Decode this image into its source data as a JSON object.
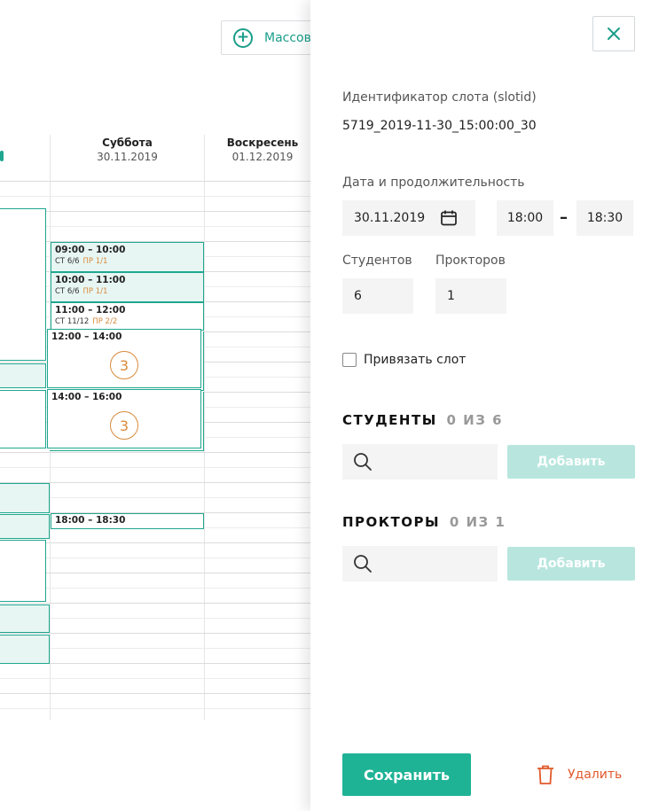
{
  "calendar": {
    "bulk_button_label": "Массов",
    "days": [
      {
        "name": "Суббота",
        "date": "30.11.2019"
      },
      {
        "name": "Воскресень",
        "date": "01.12.2019"
      }
    ],
    "slots": [
      {
        "time": "09:00 – 10:00",
        "students": "СТ 6/6",
        "proctors": "ПР 1/1"
      },
      {
        "time": "10:00 – 11:00",
        "students": "СТ 6/6",
        "proctors": "ПР 1/1"
      },
      {
        "time": "11:00 – 12:00",
        "students": "СТ 11/12",
        "proctors": "ПР 2/2"
      },
      {
        "time": "18:00 – 18:30"
      }
    ],
    "groups": [
      {
        "time": "12:00 – 14:00",
        "count": "3"
      },
      {
        "time": "14:00 – 16:00",
        "count": "3"
      }
    ]
  },
  "panel": {
    "slot_id_label": "Идентификатор слота (slotid)",
    "slot_id_value": "5719_2019-11-30_15:00:00_30",
    "date_duration_label": "Дата и продолжительность",
    "date_value": "30.11.2019",
    "time_start": "18:00",
    "time_separator": "–",
    "time_end": "18:30",
    "students_label": "Студентов",
    "students_value": "6",
    "proctors_label": "Прокторов",
    "proctors_value": "1",
    "bind_slot_label": "Привязать слот",
    "students_section": {
      "title": "СТУДЕНТЫ",
      "count": "0 ИЗ 6",
      "add_label": "Добавить"
    },
    "proctors_section": {
      "title": "ПРОКТОРЫ",
      "count": "0 ИЗ 1",
      "add_label": "Добавить"
    },
    "save_label": "Сохранить",
    "delete_label": "Удалить"
  },
  "colors": {
    "accent": "#1fb396",
    "accent_light": "#b8e6de",
    "danger": "#e05a2c",
    "badge": "#d98a3c"
  }
}
